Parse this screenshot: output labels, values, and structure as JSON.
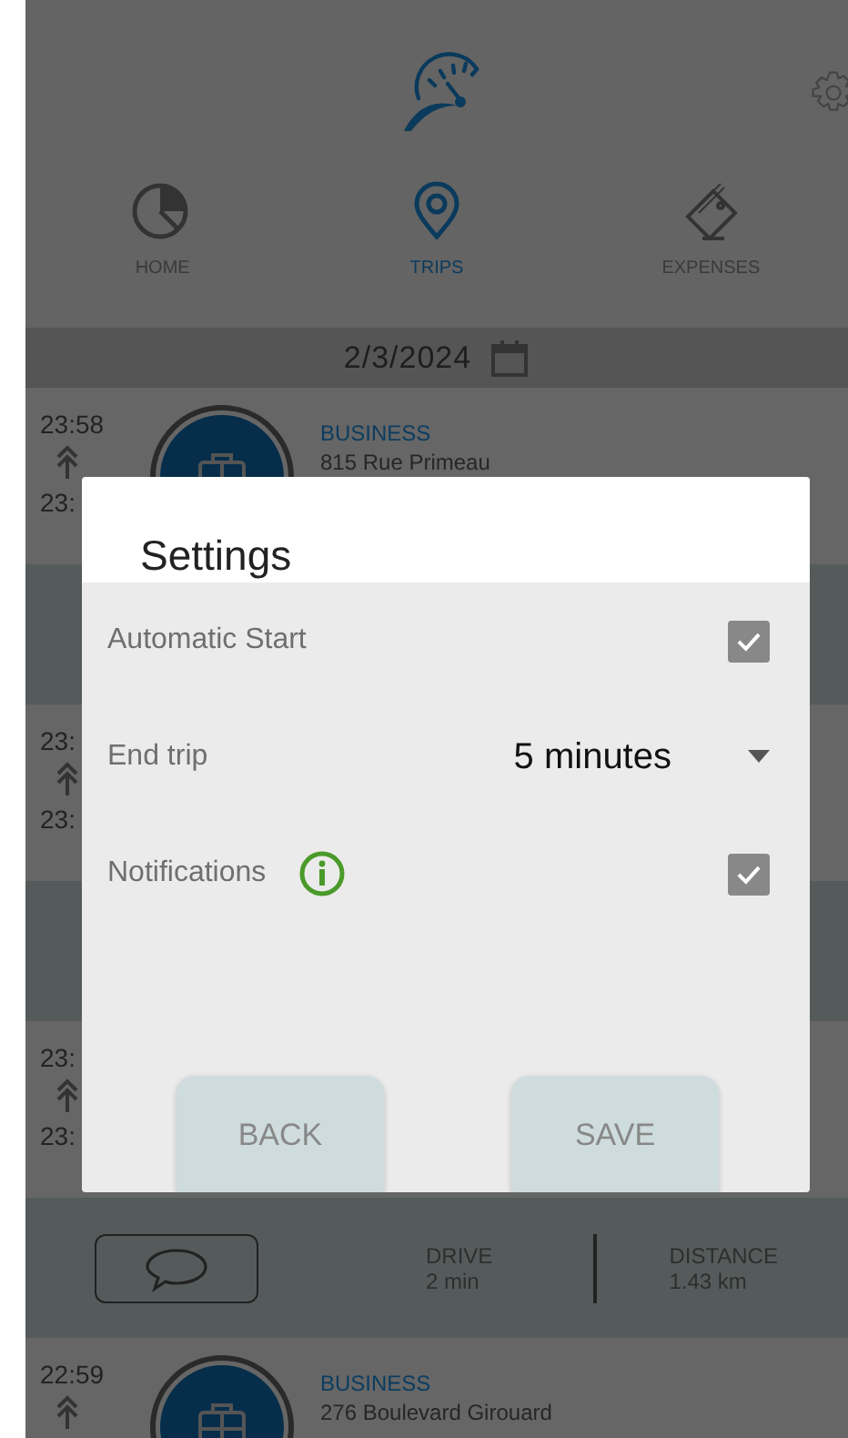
{
  "header": {
    "nav": [
      {
        "label": "HOME",
        "selected": false
      },
      {
        "label": "TRIPS",
        "selected": true
      },
      {
        "label": "EXPENSES",
        "selected": false
      }
    ]
  },
  "date_bar": {
    "date": "2/3/2024"
  },
  "list": [
    {
      "kind": "trip",
      "start_time": "23:58",
      "end_time": "23:",
      "category": "BUSINESS",
      "address": "815 Rue Primeau"
    },
    {
      "kind": "summary"
    },
    {
      "kind": "trip",
      "start_time": "23:",
      "end_time": "23:"
    },
    {
      "kind": "summary"
    },
    {
      "kind": "trip",
      "start_time": "23:",
      "end_time": "23:"
    },
    {
      "kind": "summary",
      "drive_label": "DRIVE",
      "drive": "2 min",
      "distance_label": "DISTANCE",
      "distance": "1.43 km"
    },
    {
      "kind": "trip",
      "start_time": "22:59",
      "category": "BUSINESS",
      "address": "276 Boulevard Girouard"
    }
  ],
  "dialog": {
    "title": "Settings",
    "settings": [
      {
        "kind": "checkbox",
        "label": "Automatic Start",
        "checked": true
      },
      {
        "kind": "select",
        "label": "End trip",
        "value": "5 minutes"
      },
      {
        "kind": "checkbox",
        "label": "Notifications",
        "info": true,
        "checked": true
      }
    ],
    "buttons": [
      "BACK",
      "SAVE"
    ]
  }
}
